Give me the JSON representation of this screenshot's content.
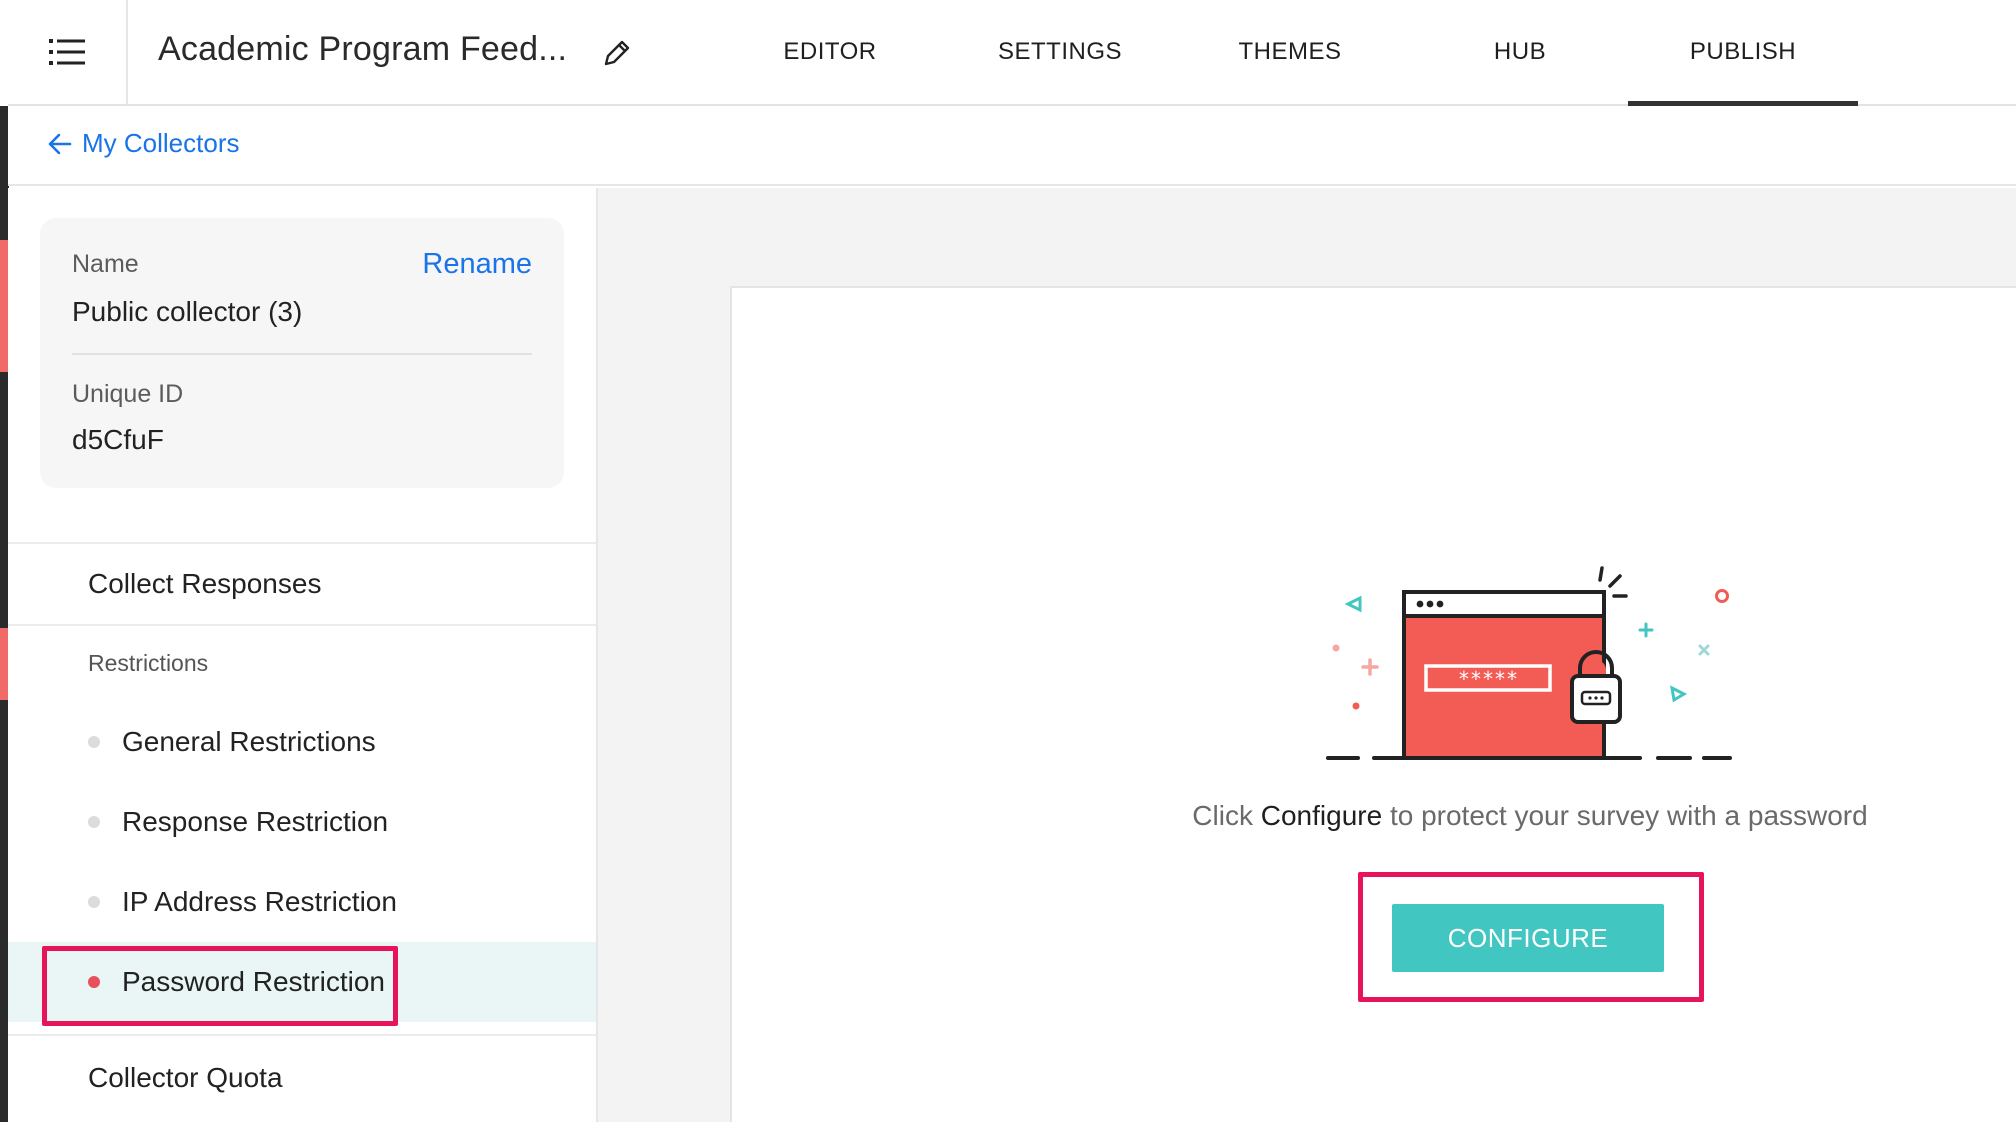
{
  "header": {
    "survey_title": "Academic Program Feed...",
    "tabs": [
      {
        "label": "EDITOR"
      },
      {
        "label": "SETTINGS"
      },
      {
        "label": "THEMES"
      },
      {
        "label": "HUB"
      },
      {
        "label": "PUBLISH",
        "active": true
      }
    ]
  },
  "breadcrumb": {
    "back_label": "My Collectors"
  },
  "collector": {
    "name_label": "Name",
    "name_value": "Public collector (3)",
    "rename_label": "Rename",
    "id_label": "Unique ID",
    "id_value": "d5CfuF"
  },
  "sidebar": {
    "collect_responses": "Collect Responses",
    "restrictions_heading": "Restrictions",
    "restriction_items": [
      {
        "label": "General Restrictions"
      },
      {
        "label": "Response Restriction"
      },
      {
        "label": "IP Address Restriction"
      },
      {
        "label": "Password Restriction",
        "active": true
      }
    ],
    "collector_quota": "Collector Quota"
  },
  "main": {
    "message_prefix": "Click",
    "message_emphasis": "Configure",
    "message_suffix": "to protect your survey with a password",
    "password_mask": "*****",
    "configure_label": "CONFIGURE"
  },
  "colors": {
    "accent_teal": "#42c6c1",
    "link_blue": "#1a73e8",
    "highlight_pink": "#e8145a",
    "illustration_red": "#f25c54",
    "active_row_bg": "#e9f6f5"
  }
}
